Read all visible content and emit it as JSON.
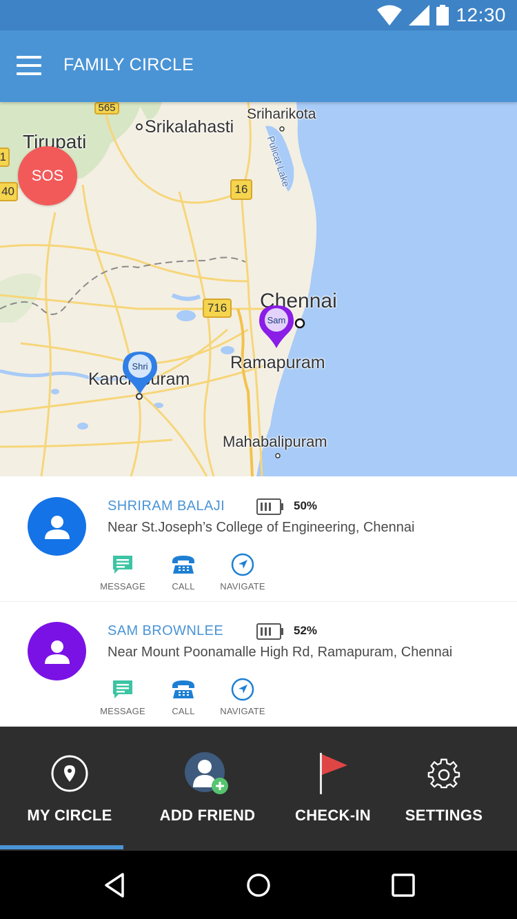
{
  "status_bar": {
    "time": "12:30",
    "icons": [
      "wifi-icon",
      "signal-icon",
      "battery-icon"
    ]
  },
  "app_bar": {
    "menu_icon": "menu-icon",
    "title": "FAMILY CIRCLE"
  },
  "map": {
    "sos_label": "SOS",
    "places": {
      "tirupati": "Tirupati",
      "srikalahasti": "Srikalahasti",
      "sriharikota": "Sriharikota",
      "pulicat_lake": "Pulicat Lake",
      "chennai": "Chennai",
      "ramapuram": "Ramapuram",
      "kanchipuram": "Kanchipuram",
      "mahabalipuram": "Mahabalipuram"
    },
    "road_shields": {
      "r565": "565",
      "r16": "16",
      "r716": "716",
      "r40": "40",
      "r1": "1"
    },
    "pins": {
      "shri": "Shri",
      "sam": "Sam"
    },
    "colors": {
      "water": "#A8CBF7",
      "land": "#F4EFE3",
      "roads": "#F6D67A",
      "shri_pin": "#2F7FE6",
      "sam_pin": "#8A1DE6"
    }
  },
  "friends": [
    {
      "name": "SHRIRAM BALAJI",
      "battery": "50%",
      "address": "Near St.Joseph’s College of Engineering, Chennai",
      "avatar_color": "#1473E6",
      "actions": {
        "message": "MESSAGE",
        "call": "CALL",
        "navigate": "NAVIGATE"
      }
    },
    {
      "name": "SAM BROWNLEE",
      "battery": "52%",
      "address": "Near Mount Poonamalle High Rd, Ramapuram, Chennai",
      "avatar_color": "#7A12E6",
      "actions": {
        "message": "MESSAGE",
        "call": "CALL",
        "navigate": "NAVIGATE"
      }
    }
  ],
  "tabs": {
    "my_circle": "MY CIRCLE",
    "add_friend": "ADD FRIEND",
    "check_in": "CHECK-IN",
    "settings": "SETTINGS",
    "active": "my_circle"
  },
  "nav_bar": {
    "back": "back-icon",
    "home": "home-icon",
    "recents": "recents-icon"
  }
}
